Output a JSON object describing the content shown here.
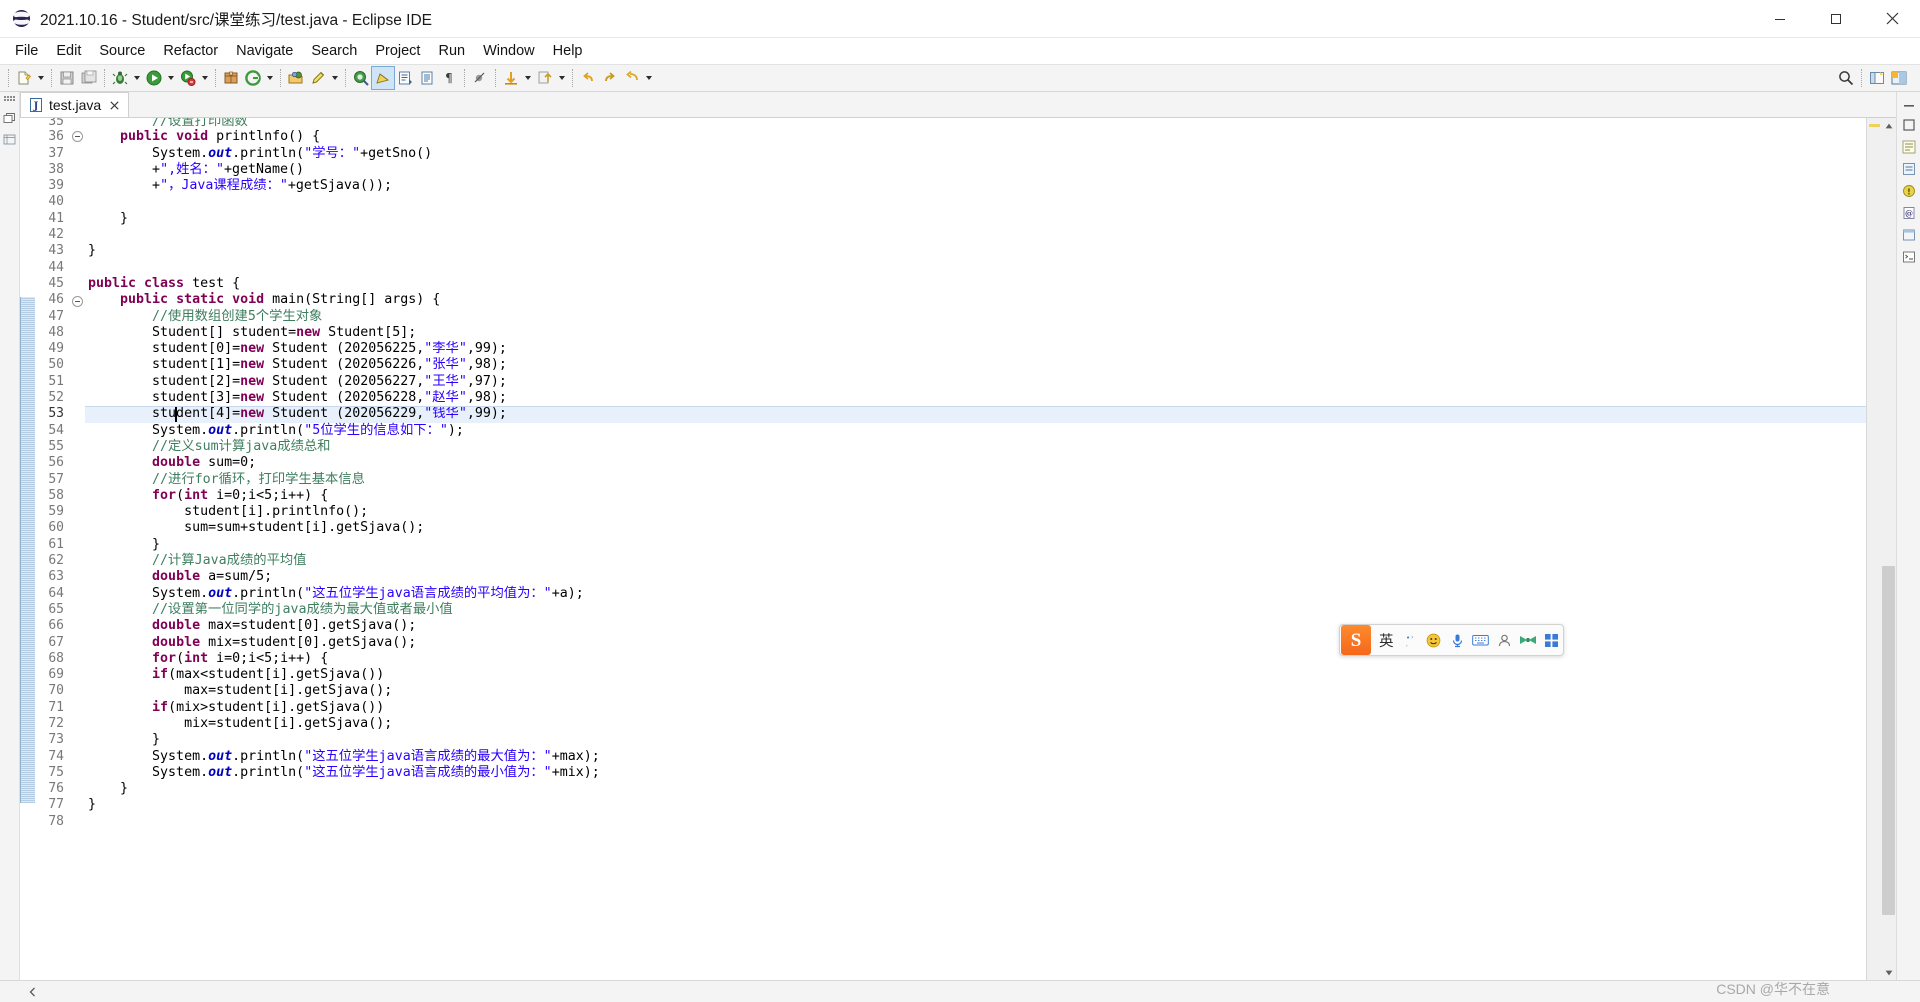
{
  "window": {
    "title": "2021.10.16 - Student/src/课堂练习/test.java - Eclipse IDE",
    "logo_name": "eclipse-logo",
    "minimize_label": "Minimize",
    "maximize_label": "Maximize",
    "close_label": "Close"
  },
  "menubar": {
    "items": [
      {
        "label": "File"
      },
      {
        "label": "Edit"
      },
      {
        "label": "Source"
      },
      {
        "label": "Refactor"
      },
      {
        "label": "Navigate"
      },
      {
        "label": "Search"
      },
      {
        "label": "Project"
      },
      {
        "label": "Run"
      },
      {
        "label": "Window"
      },
      {
        "label": "Help"
      }
    ]
  },
  "toolbar": {
    "buttons": [
      {
        "name": "new-icon",
        "glyph": "new"
      },
      {
        "name": "save-icon",
        "glyph": "save"
      },
      {
        "name": "save-all-icon",
        "glyph": "saveall"
      },
      {
        "name": "debug-icon",
        "glyph": "debug"
      },
      {
        "name": "run-icon",
        "glyph": "run"
      },
      {
        "name": "coverage-icon",
        "glyph": "coverage"
      },
      {
        "name": "new-java-package-icon",
        "glyph": "package"
      },
      {
        "name": "external-tools-icon",
        "glyph": "external"
      },
      {
        "name": "new-java-class-icon",
        "glyph": "class"
      },
      {
        "name": "search-pencil-icon",
        "glyph": "pencil"
      },
      {
        "name": "open-type-icon",
        "glyph": "opentype"
      },
      {
        "name": "toggle-mark-occurrences-icon",
        "glyph": "marker"
      },
      {
        "name": "open-task-icon",
        "glyph": "task"
      },
      {
        "name": "show-whitespace-icon",
        "glyph": "whitespace"
      },
      {
        "name": "pilcrow-icon",
        "glyph": "pilcrow"
      },
      {
        "name": "skip-breakpoints-icon",
        "glyph": "skip"
      },
      {
        "name": "next-annotation-icon",
        "glyph": "nextanno"
      },
      {
        "name": "previous-annotation-icon",
        "glyph": "prevanno"
      },
      {
        "name": "back-icon",
        "glyph": "back"
      },
      {
        "name": "forward-icon",
        "glyph": "forward"
      },
      {
        "name": "last-edit-location-icon",
        "glyph": "lastedit"
      }
    ],
    "right_buttons": [
      {
        "name": "quick-access-search-icon",
        "glyph": "search"
      },
      {
        "name": "open-perspective-icon",
        "glyph": "perspective"
      },
      {
        "name": "java-perspective-icon",
        "glyph": "java"
      }
    ]
  },
  "editor": {
    "tab": {
      "label": "test.java",
      "icon_name": "java-file-icon",
      "close_label": "×"
    },
    "first_visible_line": 35,
    "highlighted_line": 53,
    "marker_range_start_line": 46,
    "marker_range_end_line": 76,
    "caret_line": 53,
    "lines": [
      {
        "n": 35,
        "clipped": true,
        "tokens": [
          {
            "t": "        ",
            "c": "pln"
          },
          {
            "t": "//设置打印函数",
            "c": "cmt"
          }
        ]
      },
      {
        "n": 36,
        "fold": true,
        "tokens": [
          {
            "t": "    ",
            "c": "pln"
          },
          {
            "t": "public void ",
            "c": "kw"
          },
          {
            "t": "printlnfo() {",
            "c": "pln"
          }
        ]
      },
      {
        "n": 37,
        "tokens": [
          {
            "t": "        System.",
            "c": "pln"
          },
          {
            "t": "out",
            "c": "fld"
          },
          {
            "t": ".println(",
            "c": "pln"
          },
          {
            "t": "\"学号：\"",
            "c": "str"
          },
          {
            "t": "+getSno()",
            "c": "pln"
          }
        ]
      },
      {
        "n": 38,
        "tokens": [
          {
            "t": "        +",
            "c": "pln"
          },
          {
            "t": "\",姓名：\"",
            "c": "str"
          },
          {
            "t": "+getName()",
            "c": "pln"
          }
        ]
      },
      {
        "n": 39,
        "tokens": [
          {
            "t": "        +",
            "c": "pln"
          },
          {
            "t": "\"，Java课程成绩：\"",
            "c": "str"
          },
          {
            "t": "+getSjava());",
            "c": "pln"
          }
        ]
      },
      {
        "n": 40,
        "tokens": []
      },
      {
        "n": 41,
        "tokens": [
          {
            "t": "    }",
            "c": "pln"
          }
        ]
      },
      {
        "n": 42,
        "tokens": []
      },
      {
        "n": 43,
        "tokens": [
          {
            "t": "}",
            "c": "pln"
          }
        ]
      },
      {
        "n": 44,
        "tokens": []
      },
      {
        "n": 45,
        "tokens": [
          {
            "t": "public class ",
            "c": "kw"
          },
          {
            "t": "test {",
            "c": "pln"
          }
        ]
      },
      {
        "n": 46,
        "fold": true,
        "tokens": [
          {
            "t": "    ",
            "c": "pln"
          },
          {
            "t": "public static void ",
            "c": "kw"
          },
          {
            "t": "main(String[] args) {",
            "c": "pln"
          }
        ]
      },
      {
        "n": 47,
        "tokens": [
          {
            "t": "        ",
            "c": "pln"
          },
          {
            "t": "//使用数组创建5个学生对象",
            "c": "cmt"
          }
        ]
      },
      {
        "n": 48,
        "tokens": [
          {
            "t": "        Student[] student=",
            "c": "pln"
          },
          {
            "t": "new ",
            "c": "kw"
          },
          {
            "t": "Student[5];",
            "c": "pln"
          }
        ]
      },
      {
        "n": 49,
        "tokens": [
          {
            "t": "        student[0]=",
            "c": "pln"
          },
          {
            "t": "new ",
            "c": "kw"
          },
          {
            "t": "Student (202056225,",
            "c": "pln"
          },
          {
            "t": "\"李华\"",
            "c": "str"
          },
          {
            "t": ",99);",
            "c": "pln"
          }
        ]
      },
      {
        "n": 50,
        "tokens": [
          {
            "t": "        student[1]=",
            "c": "pln"
          },
          {
            "t": "new ",
            "c": "kw"
          },
          {
            "t": "Student (202056226,",
            "c": "pln"
          },
          {
            "t": "\"张华\"",
            "c": "str"
          },
          {
            "t": ",98);",
            "c": "pln"
          }
        ]
      },
      {
        "n": 51,
        "tokens": [
          {
            "t": "        student[2]=",
            "c": "pln"
          },
          {
            "t": "new ",
            "c": "kw"
          },
          {
            "t": "Student (202056227,",
            "c": "pln"
          },
          {
            "t": "\"王华\"",
            "c": "str"
          },
          {
            "t": ",97);",
            "c": "pln"
          }
        ]
      },
      {
        "n": 52,
        "tokens": [
          {
            "t": "        student[3]=",
            "c": "pln"
          },
          {
            "t": "new ",
            "c": "kw"
          },
          {
            "t": "Student (202056228,",
            "c": "pln"
          },
          {
            "t": "\"赵华\"",
            "c": "str"
          },
          {
            "t": ",98);",
            "c": "pln"
          }
        ]
      },
      {
        "n": 53,
        "highlight": true,
        "tokens": [
          {
            "t": "        student[4]=",
            "c": "pln"
          },
          {
            "t": "new ",
            "c": "kw"
          },
          {
            "t": "Student (202056229,",
            "c": "pln"
          },
          {
            "t": "\"钱华\"",
            "c": "str"
          },
          {
            "t": ",99);",
            "c": "pln"
          }
        ]
      },
      {
        "n": 54,
        "tokens": [
          {
            "t": "        System.",
            "c": "pln"
          },
          {
            "t": "out",
            "c": "fld"
          },
          {
            "t": ".println(",
            "c": "pln"
          },
          {
            "t": "\"5位学生的信息如下：\"",
            "c": "str"
          },
          {
            "t": ");",
            "c": "pln"
          }
        ]
      },
      {
        "n": 55,
        "tokens": [
          {
            "t": "        ",
            "c": "pln"
          },
          {
            "t": "//定义sum计算java成绩总和",
            "c": "cmt"
          }
        ]
      },
      {
        "n": 56,
        "tokens": [
          {
            "t": "        ",
            "c": "pln"
          },
          {
            "t": "double ",
            "c": "kw"
          },
          {
            "t": "sum=0;",
            "c": "pln"
          }
        ]
      },
      {
        "n": 57,
        "tokens": [
          {
            "t": "        ",
            "c": "pln"
          },
          {
            "t": "//进行for循环，打印学生基本信息",
            "c": "cmt"
          }
        ]
      },
      {
        "n": 58,
        "tokens": [
          {
            "t": "        ",
            "c": "pln"
          },
          {
            "t": "for",
            "c": "kw"
          },
          {
            "t": "(",
            "c": "pln"
          },
          {
            "t": "int ",
            "c": "kw"
          },
          {
            "t": "i=0;i<5;i++) {",
            "c": "pln"
          }
        ]
      },
      {
        "n": 59,
        "tokens": [
          {
            "t": "            student[i].printlnfo();",
            "c": "pln"
          }
        ]
      },
      {
        "n": 60,
        "tokens": [
          {
            "t": "            sum=sum+student[i].getSjava();",
            "c": "pln"
          }
        ]
      },
      {
        "n": 61,
        "tokens": [
          {
            "t": "        }",
            "c": "pln"
          }
        ]
      },
      {
        "n": 62,
        "tokens": [
          {
            "t": "        ",
            "c": "pln"
          },
          {
            "t": "//计算Java成绩的平均值",
            "c": "cmt"
          }
        ]
      },
      {
        "n": 63,
        "tokens": [
          {
            "t": "        ",
            "c": "pln"
          },
          {
            "t": "double ",
            "c": "kw"
          },
          {
            "t": "a=sum/5;",
            "c": "pln"
          }
        ]
      },
      {
        "n": 64,
        "tokens": [
          {
            "t": "        System.",
            "c": "pln"
          },
          {
            "t": "out",
            "c": "fld"
          },
          {
            "t": ".println(",
            "c": "pln"
          },
          {
            "t": "\"这五位学生java语言成绩的平均值为：\"",
            "c": "str"
          },
          {
            "t": "+a);",
            "c": "pln"
          }
        ]
      },
      {
        "n": 65,
        "tokens": [
          {
            "t": "        ",
            "c": "pln"
          },
          {
            "t": "//设置第一位同学的java成绩为最大值或者最小值",
            "c": "cmt"
          }
        ]
      },
      {
        "n": 66,
        "tokens": [
          {
            "t": "        ",
            "c": "pln"
          },
          {
            "t": "double ",
            "c": "kw"
          },
          {
            "t": "max=student[0].getSjava();",
            "c": "pln"
          }
        ]
      },
      {
        "n": 67,
        "tokens": [
          {
            "t": "        ",
            "c": "pln"
          },
          {
            "t": "double ",
            "c": "kw"
          },
          {
            "t": "mix=student[0].getSjava();",
            "c": "pln"
          }
        ]
      },
      {
        "n": 68,
        "tokens": [
          {
            "t": "        ",
            "c": "pln"
          },
          {
            "t": "for",
            "c": "kw"
          },
          {
            "t": "(",
            "c": "pln"
          },
          {
            "t": "int ",
            "c": "kw"
          },
          {
            "t": "i=0;i<5;i++) {",
            "c": "pln"
          }
        ]
      },
      {
        "n": 69,
        "tokens": [
          {
            "t": "        ",
            "c": "pln"
          },
          {
            "t": "if",
            "c": "kw"
          },
          {
            "t": "(max<student[i].getSjava())",
            "c": "pln"
          }
        ]
      },
      {
        "n": 70,
        "tokens": [
          {
            "t": "            max=student[i].getSjava();",
            "c": "pln"
          }
        ]
      },
      {
        "n": 71,
        "tokens": [
          {
            "t": "        ",
            "c": "pln"
          },
          {
            "t": "if",
            "c": "kw"
          },
          {
            "t": "(mix>student[i].getSjava())",
            "c": "pln"
          }
        ]
      },
      {
        "n": 72,
        "tokens": [
          {
            "t": "            mix=student[i].getSjava();",
            "c": "pln"
          }
        ]
      },
      {
        "n": 73,
        "tokens": [
          {
            "t": "        }",
            "c": "pln"
          }
        ]
      },
      {
        "n": 74,
        "tokens": [
          {
            "t": "        System.",
            "c": "pln"
          },
          {
            "t": "out",
            "c": "fld"
          },
          {
            "t": ".println(",
            "c": "pln"
          },
          {
            "t": "\"这五位学生java语言成绩的最大值为：\"",
            "c": "str"
          },
          {
            "t": "+max);",
            "c": "pln"
          }
        ]
      },
      {
        "n": 75,
        "tokens": [
          {
            "t": "        System.",
            "c": "pln"
          },
          {
            "t": "out",
            "c": "fld"
          },
          {
            "t": ".println(",
            "c": "pln"
          },
          {
            "t": "\"这五位学生java语言成绩的最小值为：\"",
            "c": "str"
          },
          {
            "t": "+mix);",
            "c": "pln"
          }
        ]
      },
      {
        "n": 76,
        "tokens": [
          {
            "t": "    }",
            "c": "pln"
          }
        ]
      },
      {
        "n": 77,
        "tokens": [
          {
            "t": "}",
            "c": "pln"
          }
        ]
      },
      {
        "n": 78,
        "tokens": []
      }
    ]
  },
  "left_rail": {
    "icons": [
      {
        "name": "restore-icon"
      },
      {
        "name": "outline-icon"
      },
      {
        "name": "package-explorer-icon"
      }
    ]
  },
  "right_rail": {
    "icons": [
      {
        "name": "minimize-view-icon"
      },
      {
        "name": "maximize-view-icon"
      },
      {
        "name": "outline-view-icon"
      },
      {
        "name": "task-list-icon"
      },
      {
        "name": "problems-view-icon"
      },
      {
        "name": "javadoc-view-icon"
      },
      {
        "name": "declaration-view-icon"
      },
      {
        "name": "console-view-icon"
      }
    ]
  },
  "scrollbar": {
    "thumb_top_pct": 52,
    "thumb_height_pct": 42
  },
  "bottombar": {
    "nav_icon": "expand-left-icon",
    "watermark": "CSDN @华不在意"
  },
  "ime": {
    "logo_letter": "S",
    "mode_label": "英",
    "buttons": [
      {
        "name": "ime-switch-icon",
        "glyph": "switch"
      },
      {
        "name": "ime-emoji-icon",
        "glyph": "emoji"
      },
      {
        "name": "ime-voice-icon",
        "glyph": "voice"
      },
      {
        "name": "ime-keyboard-icon",
        "glyph": "keyboard"
      },
      {
        "name": "ime-user-icon",
        "glyph": "user"
      },
      {
        "name": "ime-bowtie-icon",
        "glyph": "bowtie"
      },
      {
        "name": "ime-toolbox-icon",
        "glyph": "toolbox"
      }
    ]
  }
}
